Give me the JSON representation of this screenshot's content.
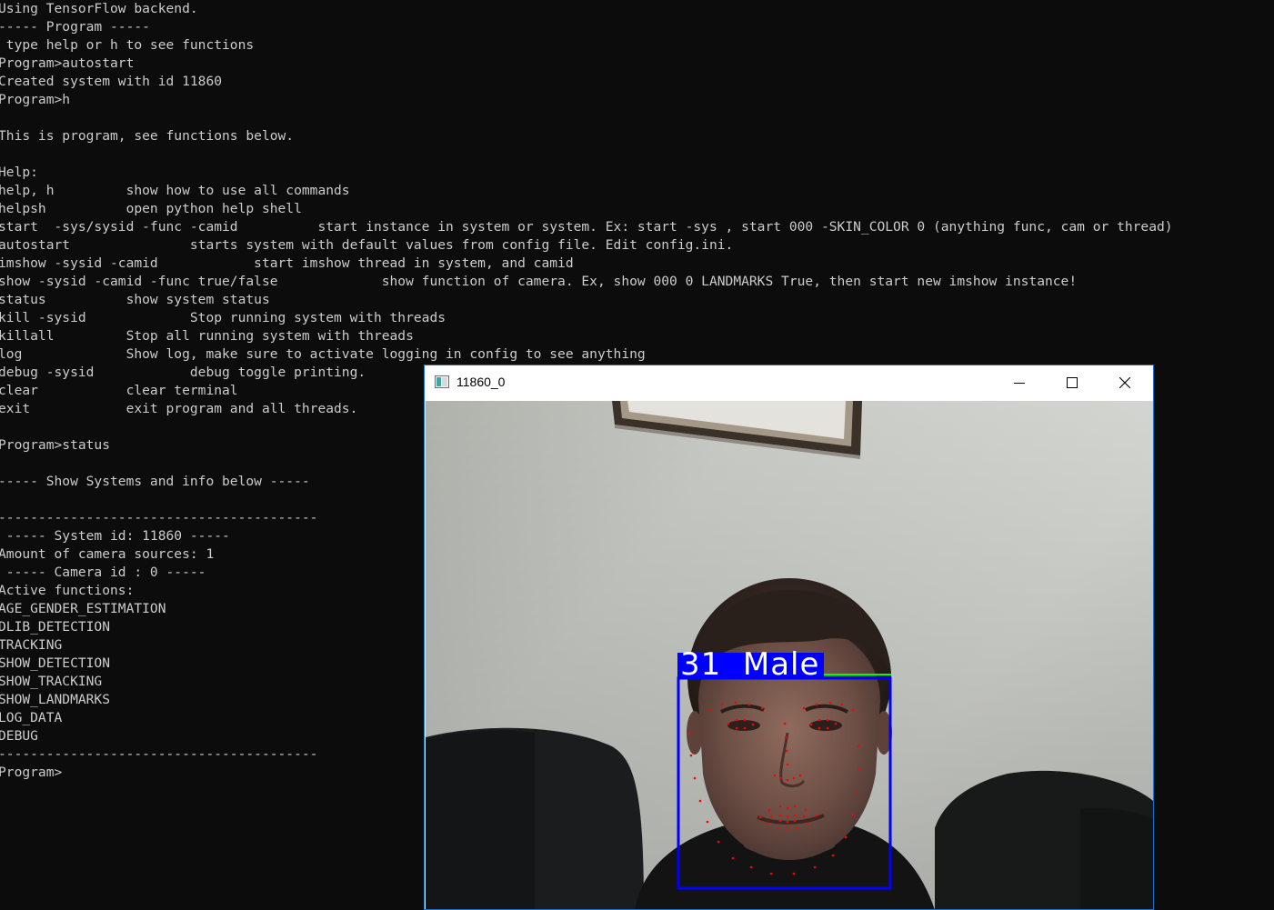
{
  "terminal": {
    "lines": [
      "Using TensorFlow backend.",
      "----- Program -----",
      " type help or h to see functions",
      "Program>autostart",
      "Created system with id 11860",
      "Program>h",
      "",
      "This is program, see functions below.",
      "",
      "Help:",
      "help, h         show how to use all commands",
      "helpsh          open python help shell",
      "start  -sys/sysid -func -camid          start instance in system or system. Ex: start -sys , start 000 -SKIN_COLOR 0 (anything func, cam or thread)",
      "autostart               starts system with default values from config file. Edit config.ini.",
      "imshow -sysid -camid            start imshow thread in system, and camid",
      "show -sysid -camid -func true/false             show function of camera. Ex, show 000 0 LANDMARKS True, then start new imshow instance!",
      "status          show system status",
      "kill -sysid             Stop running system with threads",
      "killall         Stop all running system with threads",
      "log             Show log, make sure to activate logging in config to see anything",
      "debug -sysid            debug toggle printing.",
      "clear           clear terminal",
      "exit            exit program and all threads.",
      "",
      "Program>status",
      "",
      "----- Show Systems and info below -----",
      "",
      "----------------------------------------",
      " ----- System id: 11860 -----",
      "Amount of camera sources: 1",
      " ----- Camera id : 0 -----",
      "Active functions:",
      "AGE_GENDER_ESTIMATION",
      "DLIB_DETECTION",
      "TRACKING",
      "SHOW_DETECTION",
      "SHOW_TRACKING",
      "SHOW_LANDMARKS",
      "LOG_DATA",
      "DEBUG",
      "----------------------------------------",
      "Program>"
    ]
  },
  "window": {
    "title": "11860_0",
    "icon": "opencv-window-icon",
    "controls": [
      "minimize-icon",
      "maximize-icon",
      "close-icon"
    ]
  },
  "detection": {
    "label": "31  Male",
    "age": 31,
    "gender": "Male",
    "box_color": "#0000ff",
    "tracking_color": "#00ff00",
    "landmark_color": "#ff0000"
  },
  "colors": {
    "terminal_bg": "#0c0c0c",
    "terminal_fg": "#cccccc",
    "window_border": "#1a6fc9"
  }
}
